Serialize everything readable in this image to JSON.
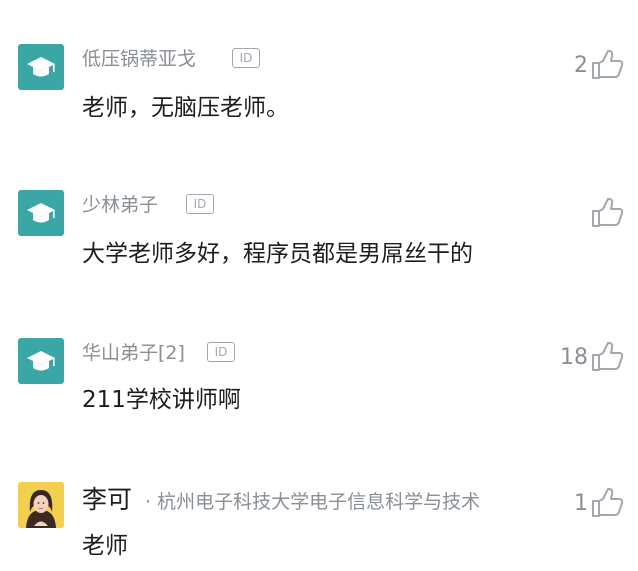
{
  "comments": [
    {
      "username": "低压锅蒂亚戈",
      "id_badge": "ID",
      "content": "老师，无脑压老师。",
      "likes": "2",
      "avatar": "graduation-cap-icon"
    },
    {
      "username": "少林弟子",
      "id_badge": "ID",
      "content": "大学老师多好，程序员都是男屌丝干的",
      "likes": "",
      "avatar": "graduation-cap-icon"
    },
    {
      "username": "华山弟子[2]",
      "id_badge": "ID",
      "content": "211学校讲师啊",
      "likes": "18",
      "avatar": "graduation-cap-icon"
    },
    {
      "username": "李可",
      "school": "· 杭州电子科技大学电子信息科学与技术",
      "content": "老师",
      "likes": "1",
      "avatar": "user-photo"
    }
  ],
  "colors": {
    "avatar_teal": "#3aa6a6",
    "muted_text": "#8a8f96",
    "main_text": "#1d1d1d",
    "icon_gray": "#a3a8ae"
  }
}
